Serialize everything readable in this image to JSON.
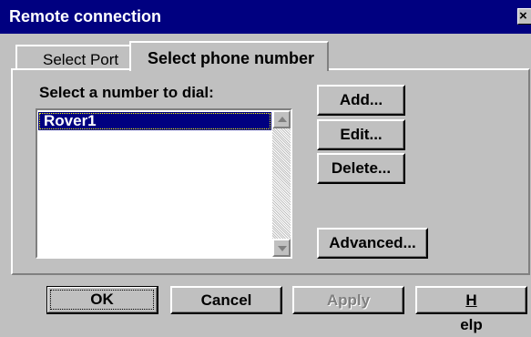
{
  "window": {
    "title": "Remote connection",
    "close_glyph": "×"
  },
  "tabs": [
    {
      "label": "Select Port",
      "active": false
    },
    {
      "label": "Select phone number",
      "active": true
    }
  ],
  "phone_tab": {
    "list_label": "Select a number to dial:",
    "numbers": [
      "Rover1"
    ],
    "selected": "Rover1",
    "buttons": {
      "add": "Add...",
      "edit": "Edit...",
      "delete": "Delete...",
      "advanced": "Advanced..."
    }
  },
  "footer": {
    "ok": "OK",
    "cancel": "Cancel",
    "apply": "Apply",
    "help_mnemonic": "H",
    "help_rest": "elp"
  },
  "colors": {
    "titlebar": "#000080",
    "face": "#c0c0c0",
    "selection": "#000080",
    "disabled_text": "#808080"
  }
}
